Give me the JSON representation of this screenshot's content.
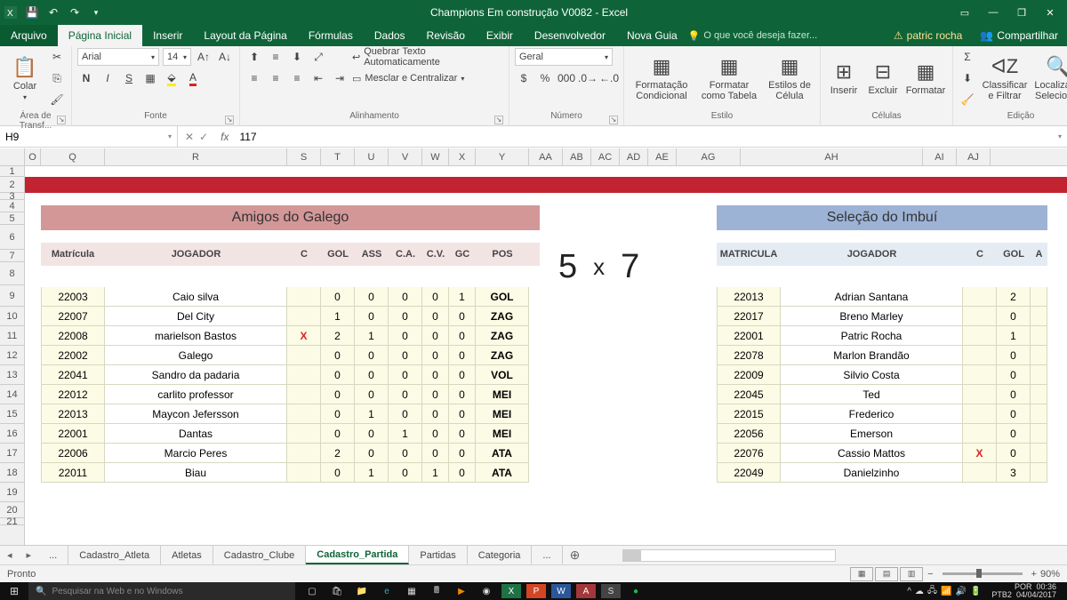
{
  "titlebar": {
    "title": "Champions Em construção V0082 - Excel"
  },
  "window_controls": {
    "ribbon_opts": "▭",
    "min": "—",
    "max": "❐",
    "close": "✕"
  },
  "tabs": {
    "file": "Arquivo",
    "home": "Página Inicial",
    "insert": "Inserir",
    "layout": "Layout da Página",
    "formulas": "Fórmulas",
    "data": "Dados",
    "review": "Revisão",
    "view": "Exibir",
    "developer": "Desenvolvedor",
    "new_guide": "Nova Guia",
    "tell_me": "O que você deseja fazer...",
    "user": "patric rocha",
    "share": "Compartilhar"
  },
  "ribbon": {
    "clipboard": {
      "paste": "Colar",
      "label": "Área de Transf..."
    },
    "font": {
      "name": "Arial",
      "size": "14",
      "label": "Fonte"
    },
    "alignment": {
      "wrap": "Quebrar Texto Automaticamente",
      "merge": "Mesclar e Centralizar",
      "label": "Alinhamento"
    },
    "number": {
      "format": "Geral",
      "label": "Número"
    },
    "styles": {
      "cond": "Formatação Condicional",
      "table": "Formatar como Tabela",
      "cell": "Estilos de Célula",
      "label": "Estilo"
    },
    "cells": {
      "insert": "Inserir",
      "delete": "Excluir",
      "format": "Formatar",
      "label": "Células"
    },
    "editing": {
      "sort": "Classificar e Filtrar",
      "find": "Localizar e Selecionar",
      "label": "Edição"
    }
  },
  "formula_bar": {
    "name_box": "H9",
    "formula": "117"
  },
  "columns": [
    "O",
    "Q",
    "R",
    "S",
    "T",
    "U",
    "V",
    "W",
    "X",
    "Y",
    "AA",
    "AB",
    "AC",
    "AD",
    "AE",
    "AG",
    "AH",
    "AI",
    "AJ"
  ],
  "rows": [
    "1",
    "2",
    "3",
    "4",
    "5",
    "6",
    "7",
    "8",
    "9",
    "10",
    "11",
    "12",
    "13",
    "14",
    "15",
    "16",
    "17",
    "18",
    "19",
    "20",
    "21"
  ],
  "team1": {
    "name": "Amigos do Galego",
    "headers": {
      "mat": "Matrícula",
      "jog": "JOGADOR",
      "c": "C",
      "gol": "GOL",
      "ass": "ASS",
      "ca": "C.A.",
      "cv": "C.V.",
      "gc": "GC",
      "pos": "POS"
    },
    "rows": [
      {
        "mat": "22003",
        "jog": "Caio silva",
        "c": "",
        "gol": "0",
        "ass": "0",
        "ca": "0",
        "cv": "0",
        "gc": "1",
        "pos": "GOL"
      },
      {
        "mat": "22007",
        "jog": "Del City",
        "c": "",
        "gol": "1",
        "ass": "0",
        "ca": "0",
        "cv": "0",
        "gc": "0",
        "pos": "ZAG"
      },
      {
        "mat": "22008",
        "jog": "marielson Bastos",
        "c": "X",
        "gol": "2",
        "ass": "1",
        "ca": "0",
        "cv": "0",
        "gc": "0",
        "pos": "ZAG"
      },
      {
        "mat": "22002",
        "jog": "Galego",
        "c": "",
        "gol": "0",
        "ass": "0",
        "ca": "0",
        "cv": "0",
        "gc": "0",
        "pos": "ZAG"
      },
      {
        "mat": "22041",
        "jog": "Sandro da padaria",
        "c": "",
        "gol": "0",
        "ass": "0",
        "ca": "0",
        "cv": "0",
        "gc": "0",
        "pos": "VOL"
      },
      {
        "mat": "22012",
        "jog": "carlito professor",
        "c": "",
        "gol": "0",
        "ass": "0",
        "ca": "0",
        "cv": "0",
        "gc": "0",
        "pos": "MEI"
      },
      {
        "mat": "22013",
        "jog": "Maycon Jefersson",
        "c": "",
        "gol": "0",
        "ass": "1",
        "ca": "0",
        "cv": "0",
        "gc": "0",
        "pos": "MEI"
      },
      {
        "mat": "22001",
        "jog": "Dantas",
        "c": "",
        "gol": "0",
        "ass": "0",
        "ca": "1",
        "cv": "0",
        "gc": "0",
        "pos": "MEI"
      },
      {
        "mat": "22006",
        "jog": "Marcio Peres",
        "c": "",
        "gol": "2",
        "ass": "0",
        "ca": "0",
        "cv": "0",
        "gc": "0",
        "pos": "ATA"
      },
      {
        "mat": "22011",
        "jog": "Biau",
        "c": "",
        "gol": "0",
        "ass": "1",
        "ca": "0",
        "cv": "1",
        "gc": "0",
        "pos": "ATA"
      }
    ]
  },
  "team2": {
    "name": "Seleção do Imbuí",
    "headers": {
      "mat": "MATRICULA",
      "jog": "JOGADOR",
      "c": "C",
      "gol": "GOL",
      "ass": "A"
    },
    "rows": [
      {
        "mat": "22013",
        "jog": "Adrian Santana",
        "c": "",
        "gol": "2"
      },
      {
        "mat": "22017",
        "jog": "Breno Marley",
        "c": "",
        "gol": "0"
      },
      {
        "mat": "22001",
        "jog": "Patric Rocha",
        "c": "",
        "gol": "1"
      },
      {
        "mat": "22078",
        "jog": "Marlon Brandão",
        "c": "",
        "gol": "0"
      },
      {
        "mat": "22009",
        "jog": "Silvio Costa",
        "c": "",
        "gol": "0"
      },
      {
        "mat": "22045",
        "jog": "Ted",
        "c": "",
        "gol": "0"
      },
      {
        "mat": "22015",
        "jog": "Frederico",
        "c": "",
        "gol": "0"
      },
      {
        "mat": "22056",
        "jog": "Emerson",
        "c": "",
        "gol": "0"
      },
      {
        "mat": "22076",
        "jog": "Cassio Mattos",
        "c": "X",
        "gol": "0"
      },
      {
        "mat": "22049",
        "jog": "Danielzinho",
        "c": "",
        "gol": "3"
      }
    ]
  },
  "score": {
    "home": "5",
    "sep": "x",
    "away": "7"
  },
  "sheet_tabs": {
    "nav_more": "...",
    "tabs": [
      "Cadastro_Atleta",
      "Atletas",
      "Cadastro_Clube",
      "Cadastro_Partida",
      "Partidas",
      "Categoria",
      "..."
    ],
    "active_index": 3
  },
  "statusbar": {
    "ready": "Pronto",
    "zoom": "90%",
    "minus": "−",
    "plus": "+"
  },
  "taskbar": {
    "search_placeholder": "Pesquisar na Web e no Windows",
    "lang": "POR",
    "kbd": "PTB2",
    "time": "00:36",
    "date": "04/04/2017"
  }
}
